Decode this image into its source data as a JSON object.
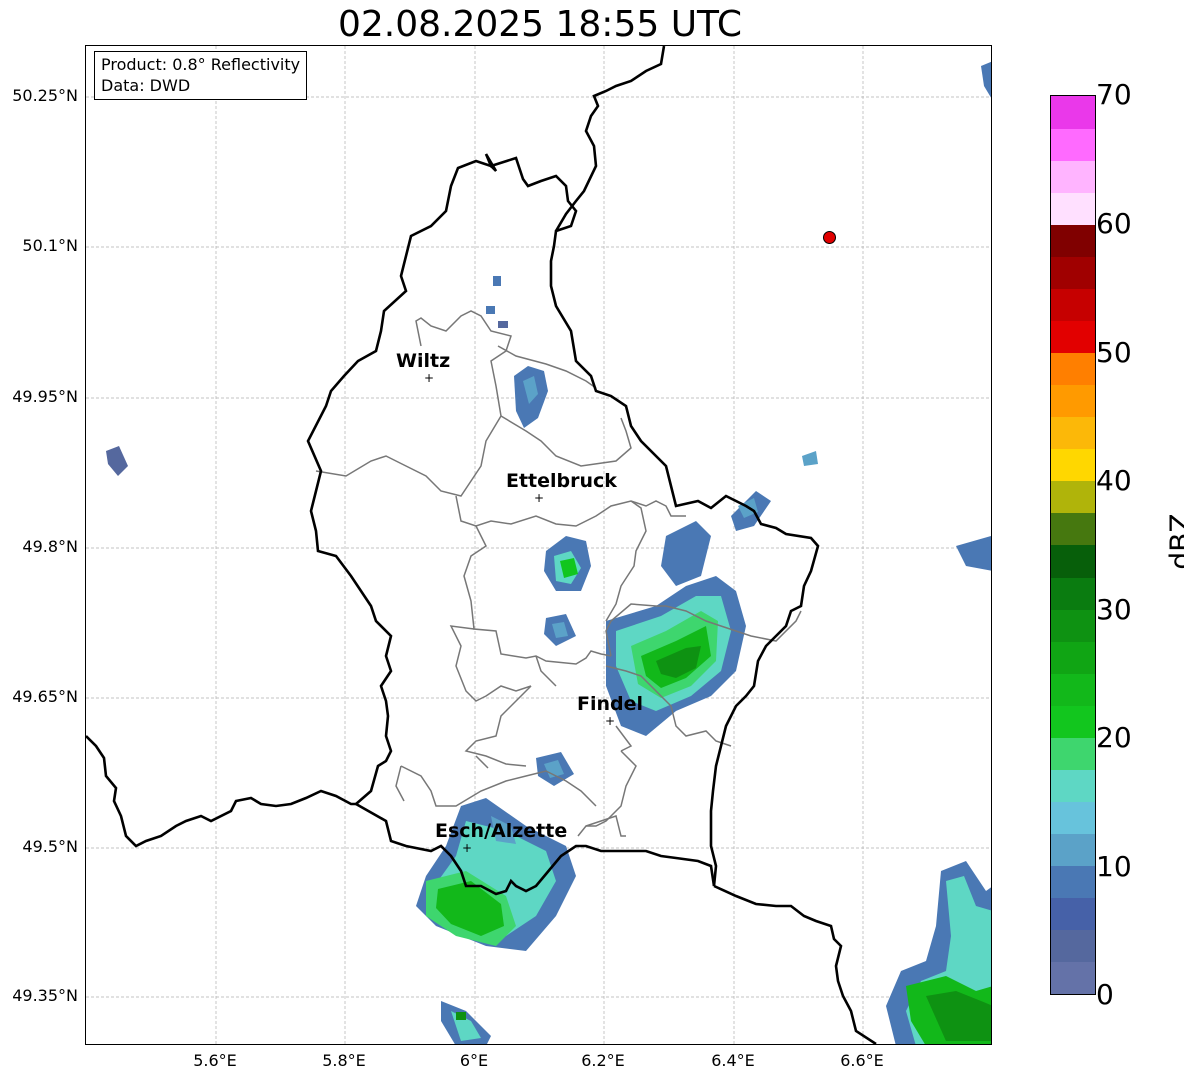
{
  "title": "02.08.2025 18:55 UTC",
  "info": {
    "product": "Product: 0.8° Reflectivity",
    "data": "Data: DWD"
  },
  "map": {
    "lon_range": [
      5.4,
      6.8
    ],
    "lat_range": [
      49.3,
      50.3
    ],
    "lat_ticks": [
      "50.25°N",
      "50.1°N",
      "49.95°N",
      "49.8°N",
      "49.65°N",
      "49.5°N",
      "49.35°N"
    ],
    "lon_ticks": [
      "5.6°E",
      "5.8°E",
      "6°E",
      "6.2°E",
      "6.4°E",
      "6.6°E"
    ],
    "cities": [
      {
        "name": "Wiltz",
        "lon": 5.935,
        "lat": 49.966
      },
      {
        "name": "Ettelbruck",
        "lon": 6.103,
        "lat": 49.847
      },
      {
        "name": "Findel",
        "lon": 6.21,
        "lat": 49.627
      },
      {
        "name": "Esch/Alzette",
        "lon": 5.99,
        "lat": 49.497
      }
    ],
    "point_of_interest": {
      "lon": 6.55,
      "lat": 50.11,
      "color": "#e00000"
    }
  },
  "colorbar": {
    "label": "dBZ",
    "min": 0,
    "max": 70,
    "ticks": [
      "0",
      "10",
      "20",
      "30",
      "40",
      "50",
      "60",
      "70"
    ],
    "colors": [
      "#6472a8",
      "#55689e",
      "#4661a8",
      "#4a78b4",
      "#5ba2c8",
      "#67c3dc",
      "#5ed7c4",
      "#3ed66e",
      "#12c61e",
      "#12b81a",
      "#10a514",
      "#0e9212",
      "#0a7c10",
      "#075f0a",
      "#46780f",
      "#b0b40a",
      "#ffd700",
      "#fcb808",
      "#ff9a00",
      "#ff7f00",
      "#e20000",
      "#c60000",
      "#a00000",
      "#800000",
      "#ffe0ff",
      "#ffb4ff",
      "#ff6aff",
      "#ea38ea"
    ]
  }
}
